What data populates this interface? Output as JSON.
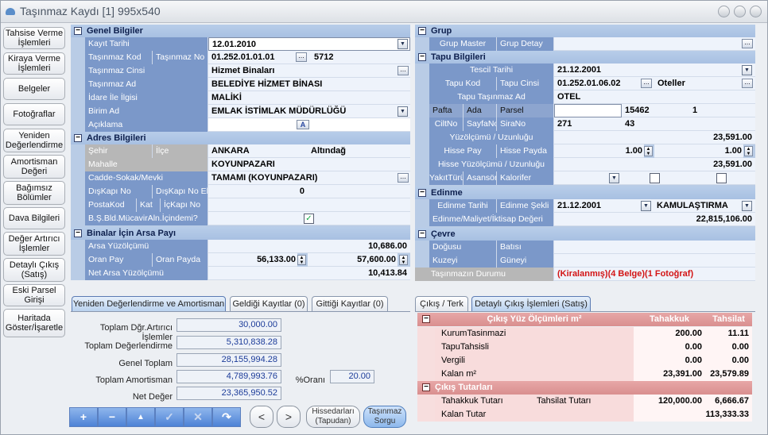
{
  "window": {
    "title": "Taşınmaz Kaydı [1] 995x540"
  },
  "sidebar": [
    "Tahsise Verme İşlemleri",
    "Kiraya Verme İşlemleri",
    "Belgeler",
    "Fotoğraflar",
    "Yeniden Değerlendirme",
    "Amortisman Değeri",
    "Bağımsız Bölümler",
    "Dava Bilgileri",
    "Değer Artırıcı İşlemler",
    "Detaylı Çıkış (Satış)",
    "Eski Parsel Girişi",
    "Haritada Göster/İşaretle"
  ],
  "genel": {
    "title": "Genel Bilgiler",
    "kayit_tarihi_l": "Kayıt Tarihi",
    "kayit_tarihi": "12.01.2010",
    "kod_l": "Taşınmaz Kod",
    "no_l": "Taşınmaz No",
    "kod": "01.252.01.01.01",
    "no": "5712",
    "cins_l": "Taşınmaz Cinsi",
    "cins": "Hizmet Binaları",
    "ad_l": "Taşınmaz Ad",
    "ad": "BELEDİYE HİZMET BİNASI",
    "idare_l": "İdare İle İlgisi",
    "idare": "MALİKİ",
    "birim_l": "Birim Ad",
    "birim": "EMLAK İSTİMLAK MÜDÜRLÜĞÜ",
    "aciklama_l": "Açıklama"
  },
  "adres": {
    "title": "Adres Bilgileri",
    "sehir_l": "Şehir",
    "ilce_l": "İlçe",
    "sehir": "ANKARA",
    "ilce": "Altındağ",
    "mahalle_l": "Mahalle",
    "mahalle": "KOYUNPAZARI",
    "cadde_l": "Cadde-Sokak/Mevki",
    "cadde": "TAMAMI (KOYUNPAZARI)",
    "diskapi_l": "DışKapı No",
    "diskapiek_l": "DışKapı No Ek",
    "diskapi": "0",
    "posta_l": "PostaKod",
    "kat_l": "Kat",
    "ickapi_l": "İçKapı No",
    "bsbld_l": "B.Ş.Bld.MücavirAln.İçindemi?"
  },
  "arsa": {
    "title": "Binalar İçin Arsa Payı",
    "yuz_l": "Arsa Yüzölçümü",
    "yuz": "10,686.00",
    "oranpay_l": "Oran Pay",
    "orpayda_l": "Oran Payda",
    "oranpay": "56,133.00",
    "orpayda": "57,600.00",
    "net_l": "Net Arsa Yüzölçümü",
    "net": "10,413.84"
  },
  "grup": {
    "title": "Grup",
    "master_l": "Grup Master",
    "detay_l": "Grup Detay"
  },
  "tapu": {
    "title": "Tapu Bilgileri",
    "tescil_l": "Tescil Tarihi",
    "tescil": "21.12.2001",
    "kod_l": "Tapu Kod",
    "cins_l": "Tapu Cinsi",
    "kod": "01.252.01.06.02",
    "cins": "Oteller",
    "ad_l": "Tapu Taşınmaz Ad",
    "ad": "OTEL",
    "pafta_l": "Pafta",
    "ada_l": "Ada",
    "parsel_l": "Parsel",
    "ada": "15462",
    "parsel": "1",
    "cilt_l": "CiltNo",
    "sayfa_l": "SayfaNo",
    "sira_l": "SiraNo",
    "cilt": "271",
    "sayfa": "43",
    "yuz_l": "Yüzölçümü / Uzunluğu",
    "yuz": "23,591.00",
    "hpay_l": "Hisse Pay",
    "hpayda_l": "Hisse Payda",
    "hpay": "1.00",
    "hpayda": "1.00",
    "hyuz_l": "Hisse Yüzölçümü / Uzunluğu",
    "hyuz": "23,591.00",
    "yakit_l": "YakıtTürü",
    "asansor_l": "Asansör",
    "kalorifer_l": "Kalorifer"
  },
  "edinme": {
    "title": "Edinme",
    "tarih_l": "Edinme Tarihi",
    "sekli_l": "Edinme Şekli",
    "tarih": "21.12.2001",
    "sekli": "KAMULAŞTIRMA",
    "maliyet_l": "Edinme/Maliyet/İktisap Değeri",
    "maliyet": "22,815,106.00"
  },
  "cevre": {
    "title": "Çevre",
    "dogu_l": "Doğusu",
    "bati_l": "Batısı",
    "kuzey_l": "Kuzeyi",
    "guney_l": "Güneyi",
    "durum_l": "Taşınmazın Durumu",
    "durum": "(Kiralanmış)(4 Belge)(1 Fotoğraf)"
  },
  "ltabs": [
    "Yeniden Değerlendirme ve Amortisman",
    "Geldiği Kayıtlar (0)",
    "Gittiği Kayıtlar (0)"
  ],
  "lvals": {
    "l1": "Toplam Dğr.Artırıcı İşlemler",
    "v1": "30,000.00",
    "l2": "Toplam Değerlendirme",
    "v2": "5,310,838.28",
    "l3": "Genel Toplam",
    "v3": "28,155,994.28",
    "l4": "Toplam Amortisman",
    "v4": "4,789,993.76",
    "oran_l": "%Oranı",
    "oran": "20.00",
    "l5": "Net Değer",
    "v5": "23,365,950.52"
  },
  "navbtns": [
    "+",
    "−",
    "▲",
    "✓",
    "✕",
    "↷"
  ],
  "prevnext": [
    "<",
    ">"
  ],
  "bbtn1": "Hissedarları (Tapudan)",
  "bbtn2": "Taşınmaz Sorgu",
  "rtabs": [
    "Çıkış / Terk",
    "Detaylı Çıkış İşlemleri (Satış)"
  ],
  "cikis": {
    "h1": "Çıkış Yüz Ölçümleri m²",
    "h2": "Tahakkuk",
    "h3": "Tahsilat",
    "rows": [
      [
        "KurumTasinmazi",
        "200.00",
        "11.11"
      ],
      [
        "TapuTahsisli",
        "0.00",
        "0.00"
      ],
      [
        "Vergili",
        "0.00",
        "0.00"
      ],
      [
        "Kalan m²",
        "23,391.00",
        "23,579.89"
      ]
    ],
    "tut_title": "Çıkış Tutarları",
    "tah_l": "Tahakkuk Tutarı",
    "tahs_l": "Tahsilat Tutarı",
    "tah": "120,000.00",
    "tahs": "6,666.67",
    "kalan_l": "Kalan Tutar",
    "kalan": "113,333.33"
  }
}
